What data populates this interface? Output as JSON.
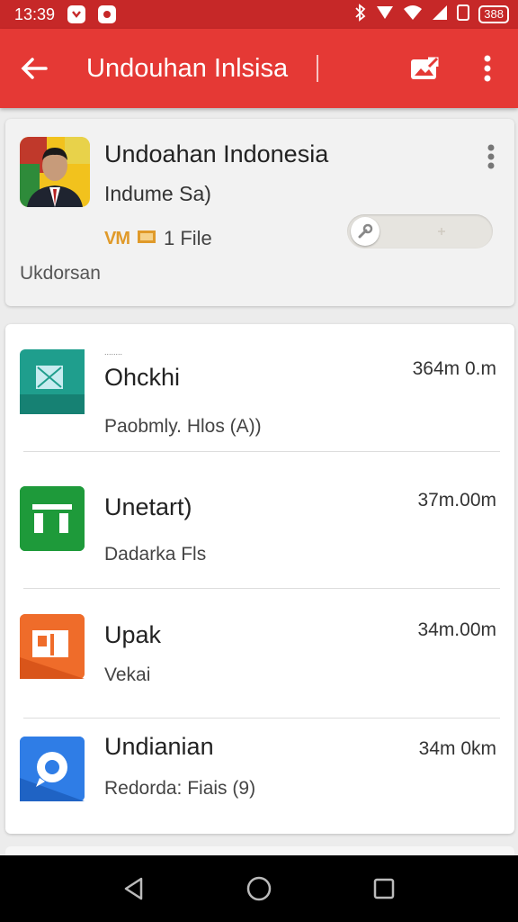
{
  "status_bar": {
    "time": "13:39",
    "battery": "388"
  },
  "app_bar": {
    "title": "Undouhan Inlsisa"
  },
  "header": {
    "title": "Undoahan Indonesia",
    "subtitle": "Indume Sa)",
    "badge": "VM",
    "file_count": "1 File",
    "meta": "Ukdorsan"
  },
  "items": [
    {
      "label_small": "........",
      "title": "Ohckhi",
      "subtitle": "Paobmly. Hlos (A))",
      "size": "364m 0.m",
      "icon": "image-file-icon",
      "color": "#1f9e8d"
    },
    {
      "title": "Unetart)",
      "subtitle": "Dadarka Fls",
      "size": "37m.00m",
      "icon": "sheets-icon",
      "color": "#1e9a3a"
    },
    {
      "title": "Upak",
      "subtitle": "Vekai",
      "size": "34m.00m",
      "icon": "slides-icon",
      "color": "#ef6c2a"
    },
    {
      "title": "Undianian",
      "subtitle": "Redorda: Fiais (9)",
      "size": "34m 0km",
      "icon": "location-icon",
      "color": "#2f7de6"
    }
  ],
  "colors": {
    "status_bar": "#c62828",
    "app_bar": "#e53935"
  }
}
